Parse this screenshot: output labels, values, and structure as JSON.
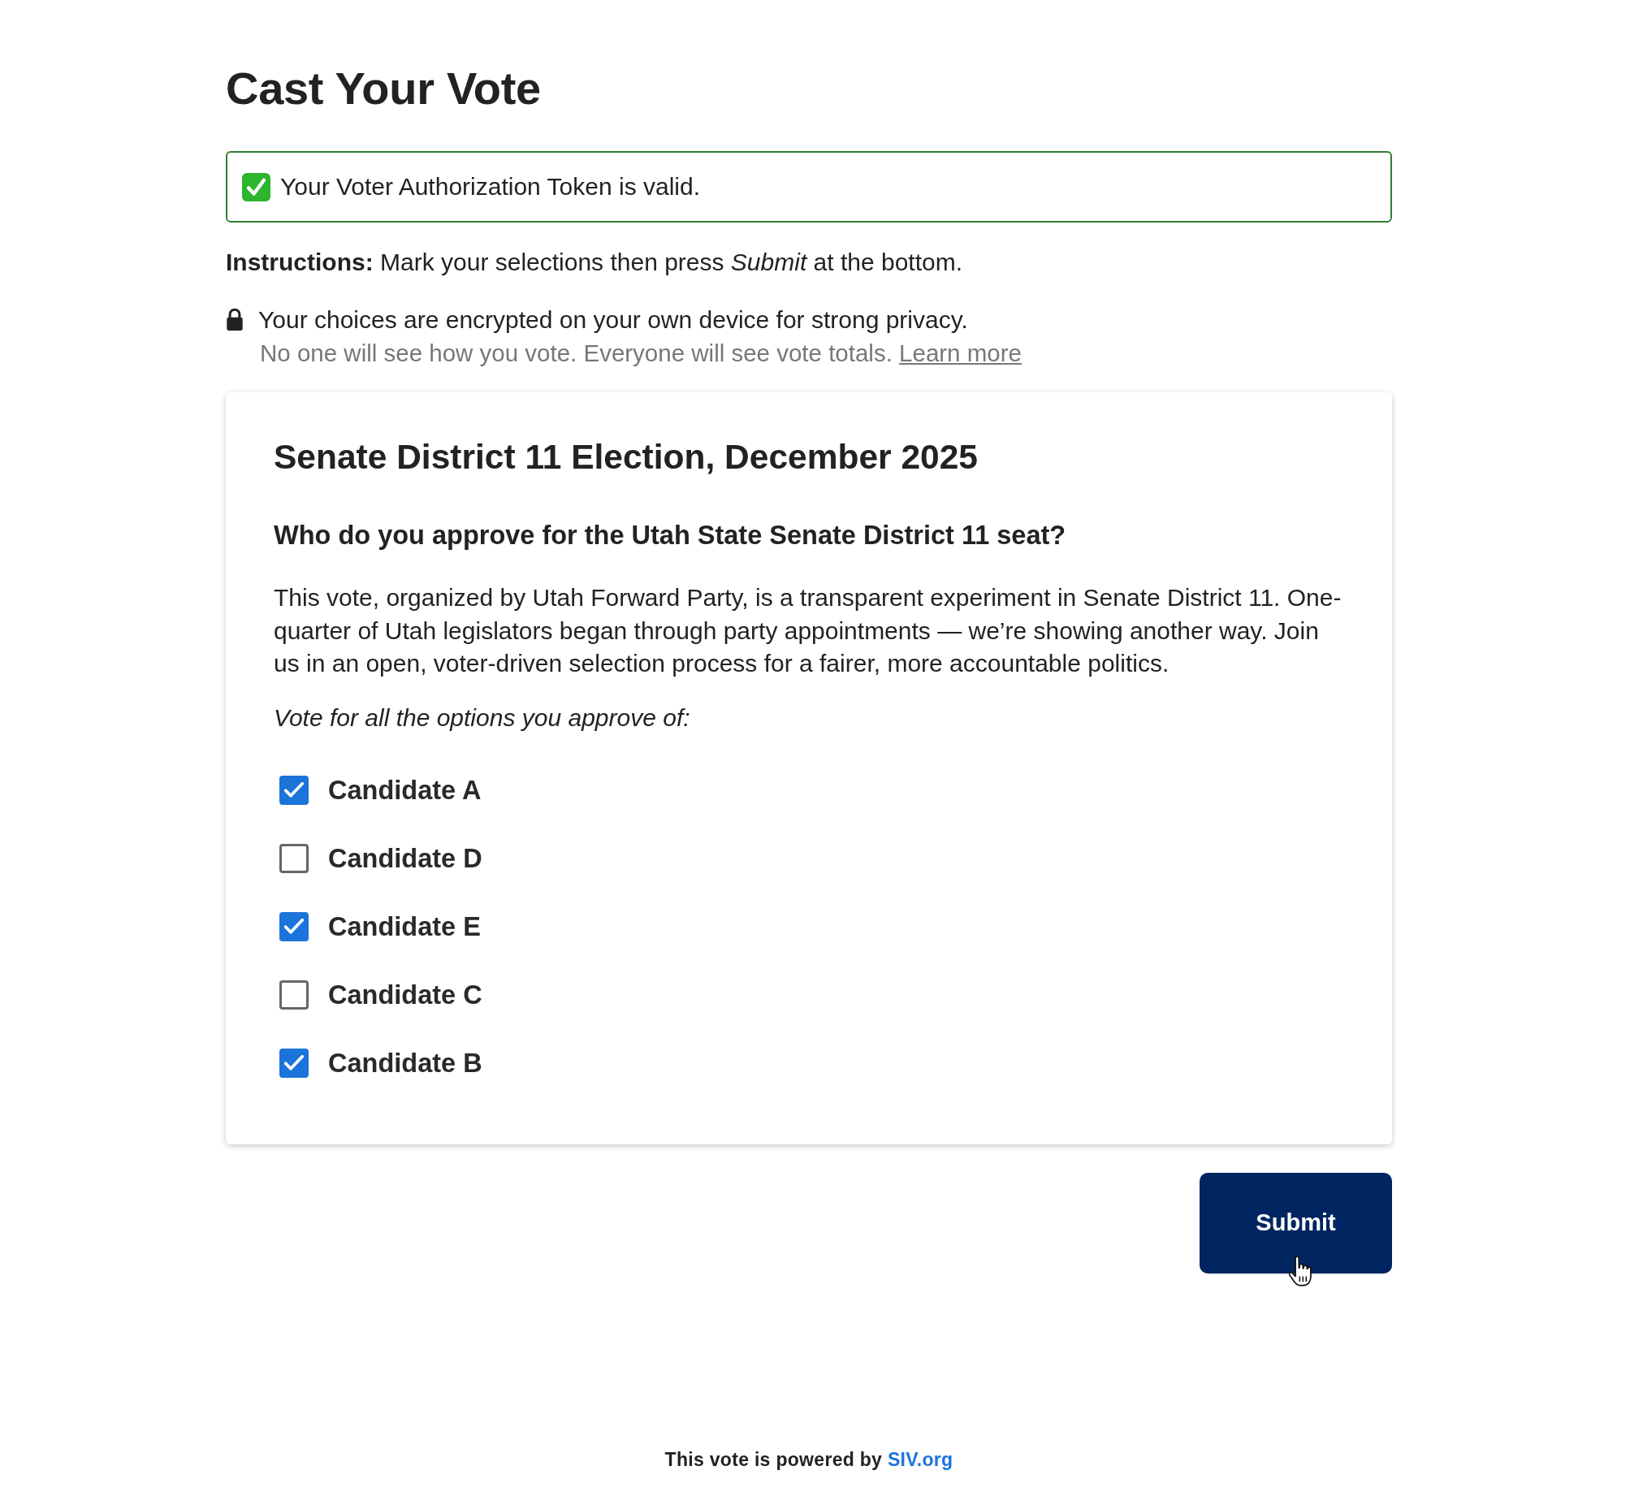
{
  "page": {
    "title": "Cast Your Vote"
  },
  "token_notice": {
    "text": "Your Voter Authorization Token is valid."
  },
  "instructions": "**Instructions:** Mark your selections then press *Submit* at the bottom.",
  "privacy": {
    "headline": "Your choices are encrypted on your own device for strong privacy.",
    "detail": "No one will see how you vote. Everyone will see vote totals.",
    "link": "Learn more"
  },
  "ballot": {
    "title": "Senate District 11 Election, December 2025",
    "question": "Who do you approve for the Utah State Senate District 11 seat?",
    "description": "This vote, organized by Utah Forward Party, is a transparent experiment in Senate District 11. One-quarter of Utah legislators began through party appointments — we’re showing another way. Join us in an open, voter-driven selection process for a fairer, more accountable politics.",
    "prompt": "Vote for all the options you approve of:",
    "options": [
      {
        "label": "Candidate A",
        "checked": true
      },
      {
        "label": "Candidate D",
        "checked": false
      },
      {
        "label": "Candidate E",
        "checked": true
      },
      {
        "label": "Candidate C",
        "checked": false
      },
      {
        "label": "Candidate B",
        "checked": true
      }
    ]
  },
  "submit_button": {
    "label": "Submit"
  },
  "footer": {
    "text": "This vote is powered by",
    "link": "SIV.org"
  }
}
